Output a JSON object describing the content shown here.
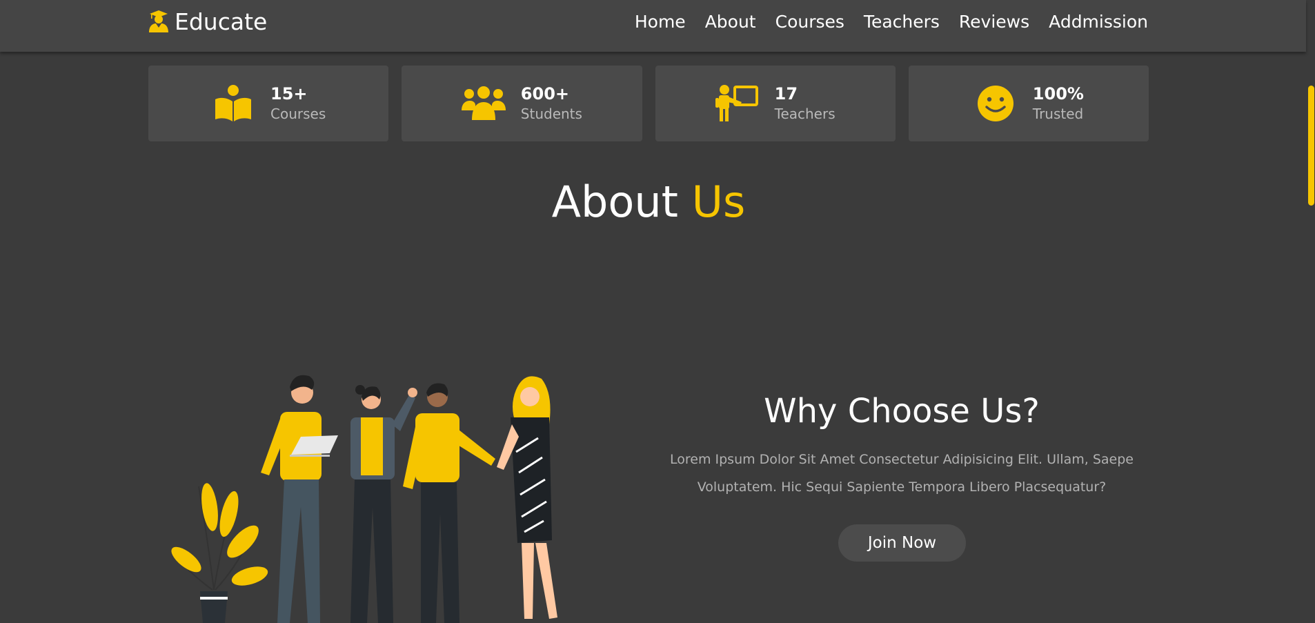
{
  "brand": {
    "name": "Educate",
    "accent": "#f6c500"
  },
  "nav": [
    "Home",
    "About",
    "Courses",
    "Teachers",
    "Reviews",
    "Addmission"
  ],
  "stats": [
    {
      "icon": "book-reader-icon",
      "value": "15+",
      "label": "Courses"
    },
    {
      "icon": "users-icon",
      "value": "600+",
      "label": "Students"
    },
    {
      "icon": "teacher-icon",
      "value": "17",
      "label": "Teachers"
    },
    {
      "icon": "smile-icon",
      "value": "100%",
      "label": "Trusted"
    }
  ],
  "about": {
    "title_main": "About",
    "title_accent": "Us"
  },
  "why": {
    "title": "Why Choose Us?",
    "text": "Lorem Ipsum Dolor Sit Amet Consectetur Adipisicing Elit. Ullam, Saepe Voluptatem. Hic Sequi Sapiente Tempora Libero Placsequatur?",
    "button": "Join Now"
  },
  "colors": {
    "background": "#3b3b3b",
    "header": "#454545",
    "card": "#4a4a4a",
    "accent": "#f6c500"
  }
}
